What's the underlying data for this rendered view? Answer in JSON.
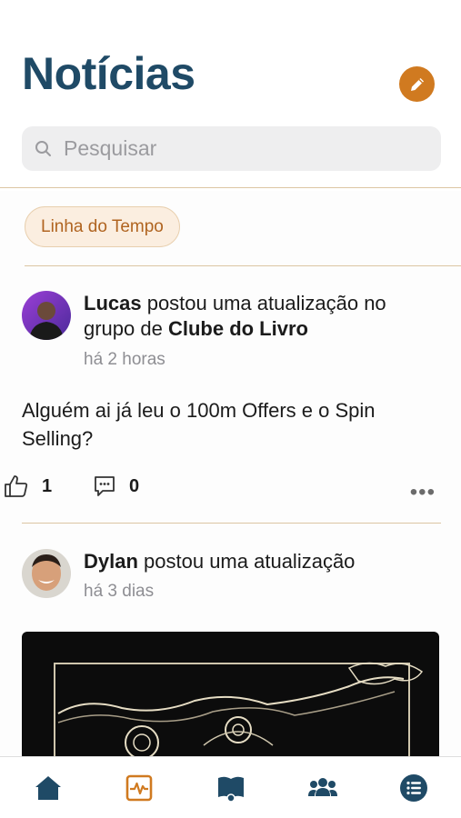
{
  "header": {
    "title": "Notícias",
    "edit_icon": "pencil-icon",
    "accent": "#d07a20",
    "title_color": "#1f4a66"
  },
  "search": {
    "placeholder": "Pesquisar",
    "icon": "search-icon"
  },
  "filters": {
    "active": "Linha do Tempo"
  },
  "posts": [
    {
      "author": "Lucas",
      "action": " postou uma atualização no grupo de ",
      "group": "Clube do Livro",
      "time": "há 2 horas",
      "body": "Alguém ai já leu o 100m Offers e o Spin Selling?",
      "likes": "1",
      "comments": "0",
      "more_label": "•••"
    },
    {
      "author": "Dylan",
      "action": " postou uma atualização",
      "time": "há 3 dias"
    }
  ],
  "tabbar": {
    "items": [
      "home-icon",
      "activity-icon",
      "book-icon",
      "groups-icon",
      "list-icon"
    ],
    "active_color": "#d07a20",
    "inactive_color": "#1f4a66"
  }
}
